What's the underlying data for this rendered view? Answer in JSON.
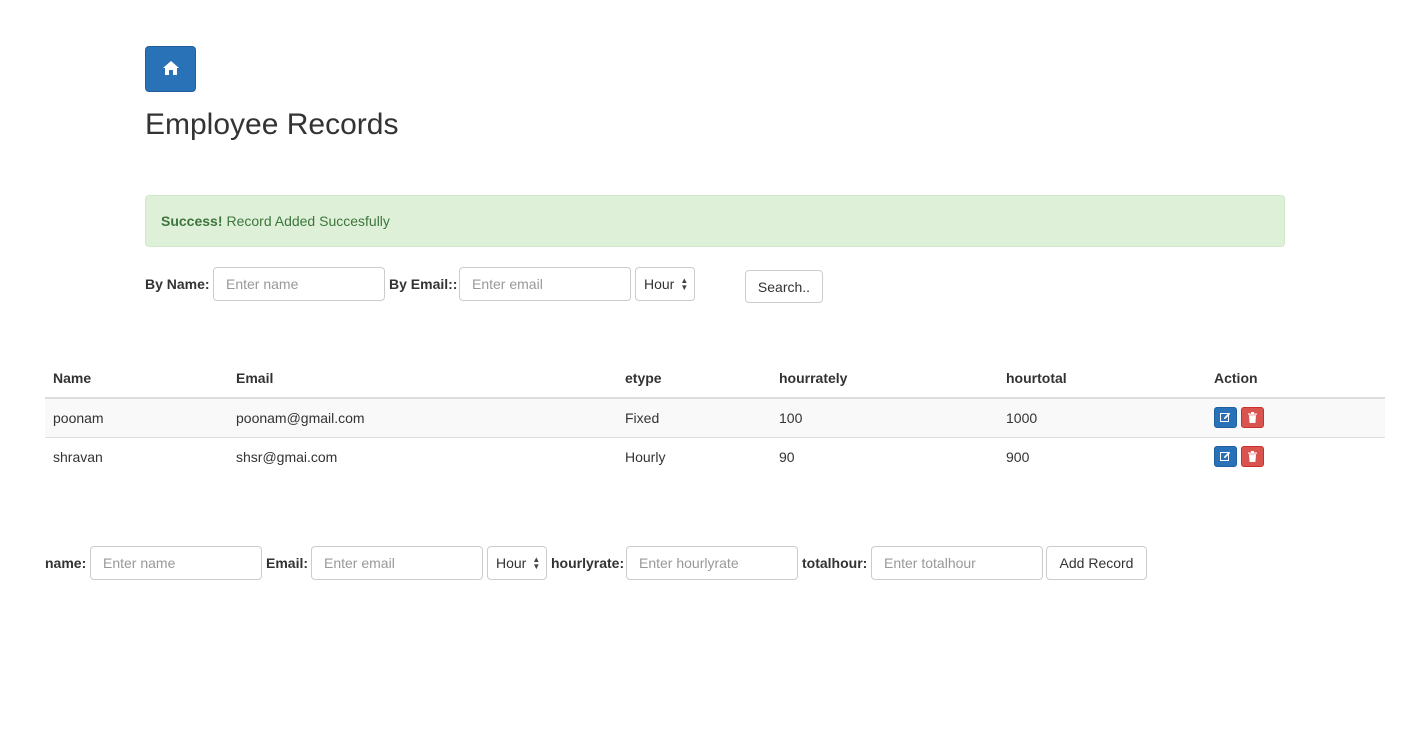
{
  "header": {
    "home_icon": "home-icon",
    "title": "Employee Records"
  },
  "alert": {
    "strong": "Success!",
    "message": "Record Added Succesfully"
  },
  "search": {
    "name_label": "By Name:",
    "name_placeholder": "Enter name",
    "email_label": "By Email::",
    "email_placeholder": "Enter email",
    "type_selected": "Hour",
    "button_label": "Search.."
  },
  "table": {
    "headers": [
      "Name",
      "Email",
      "etype",
      "hourrately",
      "hourtotal",
      "Action"
    ],
    "rows": [
      {
        "name": "poonam",
        "email": "poonam@gmail.com",
        "etype": "Fixed",
        "hourrately": "100",
        "hourtotal": "1000"
      },
      {
        "name": "shravan",
        "email": "shsr@gmai.com",
        "etype": "Hourly",
        "hourrately": "90",
        "hourtotal": "900"
      }
    ],
    "edit_icon": "edit-icon",
    "delete_icon": "trash-icon"
  },
  "add_form": {
    "name_label": "name:",
    "name_placeholder": "Enter name",
    "email_label": "Email:",
    "email_placeholder": "Enter email",
    "type_selected": "Hour",
    "hourlyrate_label": "hourlyrate:",
    "hourlyrate_placeholder": "Enter hourlyrate",
    "totalhour_label": "totalhour:",
    "totalhour_placeholder": "Enter totalhour",
    "button_label": "Add Record"
  },
  "colors": {
    "primary": "#2a72b8",
    "danger": "#d9534f",
    "success_bg": "#dff0d8",
    "success_text": "#3c763d"
  }
}
